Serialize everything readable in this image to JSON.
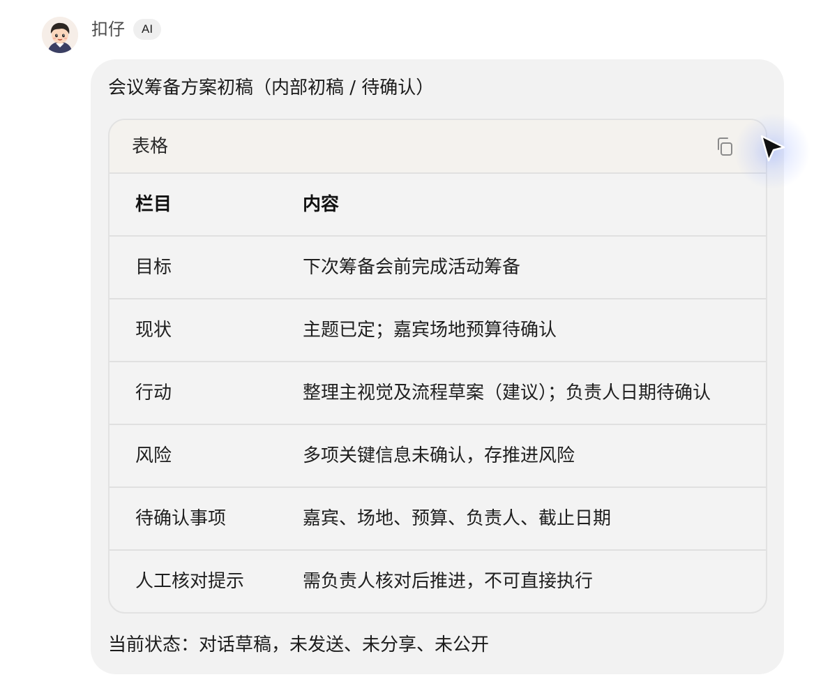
{
  "sender": {
    "name": "扣仔",
    "badge": "AI"
  },
  "message": {
    "title": "会议筹备方案初稿（内部初稿 / 待确认）",
    "table": {
      "label": "表格",
      "columns": [
        "栏目",
        "内容"
      ],
      "rows": [
        [
          "目标",
          "下次筹备会前完成活动筹备"
        ],
        [
          "现状",
          "主题已定；嘉宾场地预算待确认"
        ],
        [
          "行动",
          "整理主视觉及流程草案（建议）；负责人日期待确认"
        ],
        [
          "风险",
          "多项关键信息未确认，存推进风险"
        ],
        [
          "待确认事项",
          "嘉宾、场地、预算、负责人、截止日期"
        ],
        [
          "人工核对提示",
          "需负责人核对后推进，不可直接执行"
        ]
      ]
    },
    "status": "当前状态：对话草稿，未发送、未分享、未公开"
  },
  "icons": {
    "avatar": "avatar-cartoon-boy",
    "copy": "copy-icon",
    "cursor": "mouse-pointer-icon"
  },
  "colors": {
    "bubble": "#f2f2f2",
    "table_header": "#f4f2ee",
    "border": "#e0e0e0",
    "cursor_glow": "#8ea2ff"
  }
}
